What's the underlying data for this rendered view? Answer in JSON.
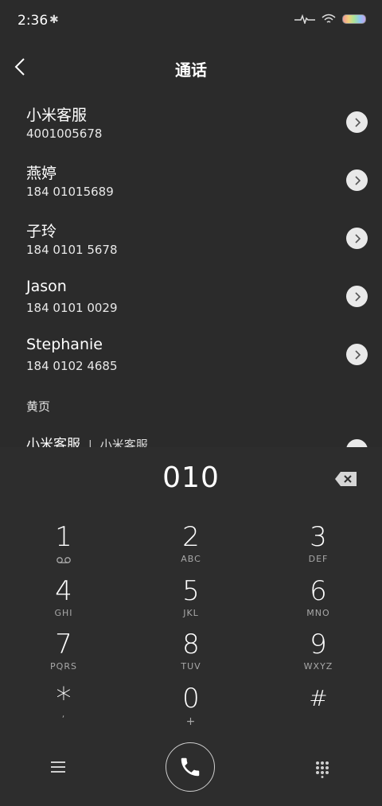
{
  "status": {
    "time": "2:36",
    "bluetooth_glyph": "✱"
  },
  "header": {
    "title": "通话"
  },
  "contacts": [
    {
      "name": "小米客服",
      "number": "4001005678"
    },
    {
      "name": "燕婷",
      "number": "184 01015689"
    },
    {
      "name": "子玲",
      "number": "184 0101 5678"
    },
    {
      "name": "Jason",
      "number": "184 0101 0029"
    },
    {
      "name": "Stephanie",
      "number": "184 0102 4685"
    }
  ],
  "yellow_pages": {
    "label": "黄页",
    "partial_name": "小米客服",
    "partial_sep": "|",
    "partial_sub": "小米客服"
  },
  "dialer": {
    "number": "010",
    "keys": [
      {
        "digit": "1",
        "letters": ""
      },
      {
        "digit": "2",
        "letters": "ABC"
      },
      {
        "digit": "3",
        "letters": "DEF"
      },
      {
        "digit": "4",
        "letters": "GHI"
      },
      {
        "digit": "5",
        "letters": "JKL"
      },
      {
        "digit": "6",
        "letters": "MNO"
      },
      {
        "digit": "7",
        "letters": "PQRS"
      },
      {
        "digit": "8",
        "letters": "TUV"
      },
      {
        "digit": "9",
        "letters": "WXYZ"
      },
      {
        "digit": "*",
        "letters": ","
      },
      {
        "digit": "0",
        "letters": "+"
      },
      {
        "digit": "#",
        "letters": ""
      }
    ]
  },
  "icons": {
    "back": "chevron-left-icon",
    "detail": "chevron-right-icon",
    "backspace": "backspace-icon",
    "menu": "menu-icon",
    "call": "phone-icon",
    "dialpad": "dialpad-grid-icon",
    "voicemail": "voicemail-icon"
  }
}
